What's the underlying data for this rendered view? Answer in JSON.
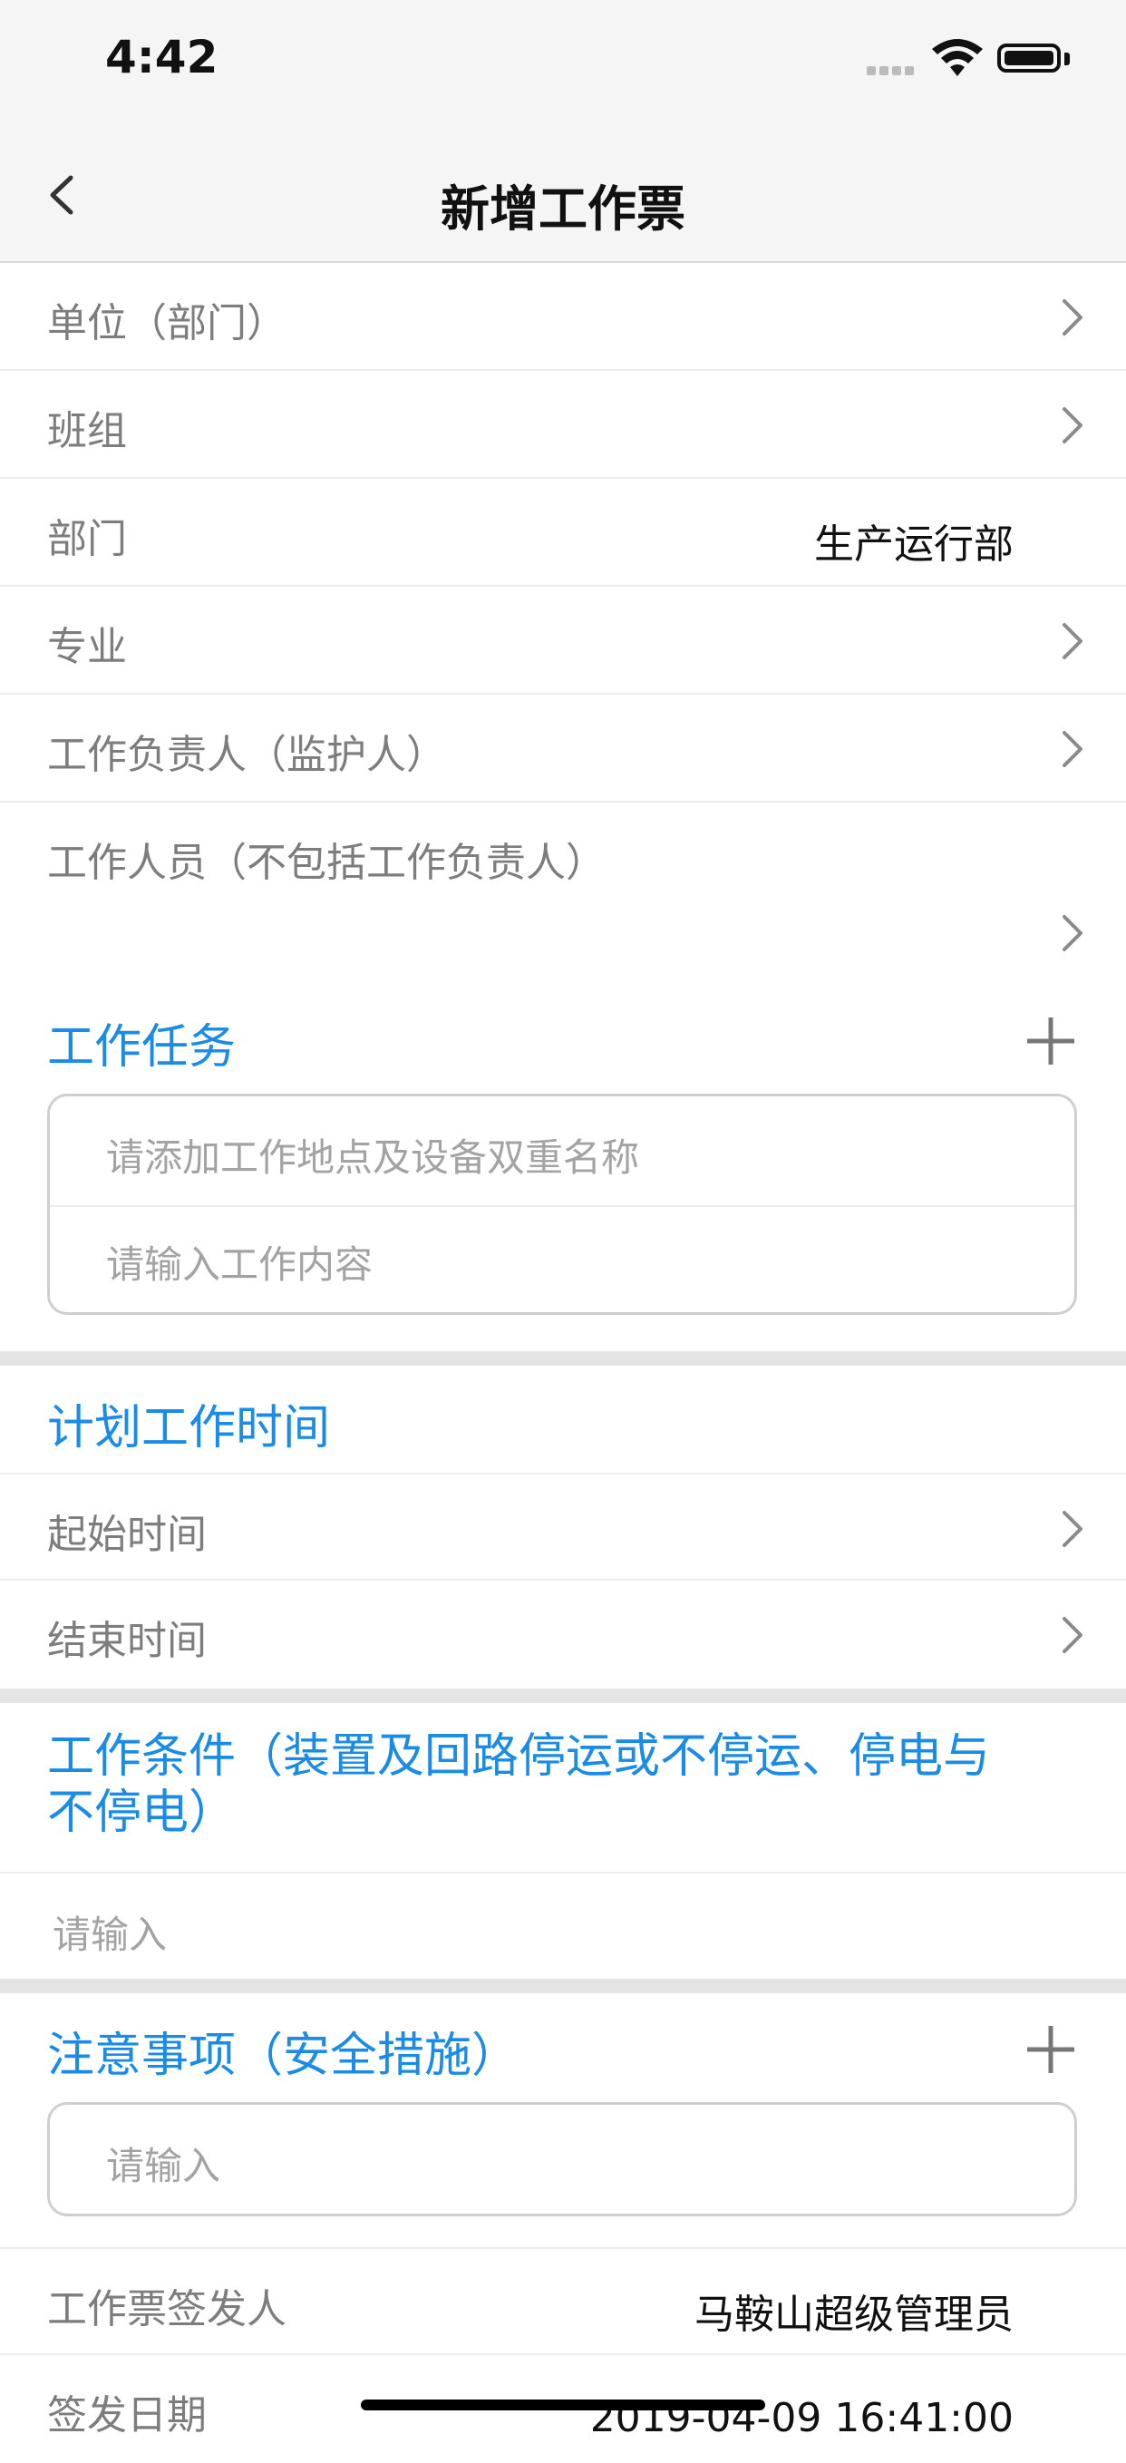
{
  "status": {
    "time": "4:42"
  },
  "nav": {
    "title": "新增工作票"
  },
  "rows": {
    "unit": "单位（部门）",
    "team": "班组",
    "dept": "部门",
    "dept_value": "生产运行部",
    "specialty": "专业",
    "leader": "工作负责人（监护人）",
    "members": "工作人员（不包括工作负责人）"
  },
  "task": {
    "title": "工作任务",
    "location_placeholder": "请添加工作地点及设备双重名称",
    "content_placeholder": "请输入工作内容"
  },
  "schedule": {
    "title": "计划工作时间",
    "start": "起始时间",
    "end": "结束时间"
  },
  "conditions": {
    "title": "工作条件（装置及回路停运或不停运、停电与不停电）",
    "placeholder": "请输入"
  },
  "notes": {
    "title": "注意事项（安全措施）",
    "placeholder": "请输入"
  },
  "issuer": {
    "label": "工作票签发人",
    "value": "马鞍山超级管理员"
  },
  "sign_date": {
    "label": "签发日期",
    "value": "2019-04-09 16:41:00"
  },
  "colors": {
    "accent": "#1a8be6",
    "label": "#7d7d7d",
    "placeholder": "#a3a3a3"
  }
}
